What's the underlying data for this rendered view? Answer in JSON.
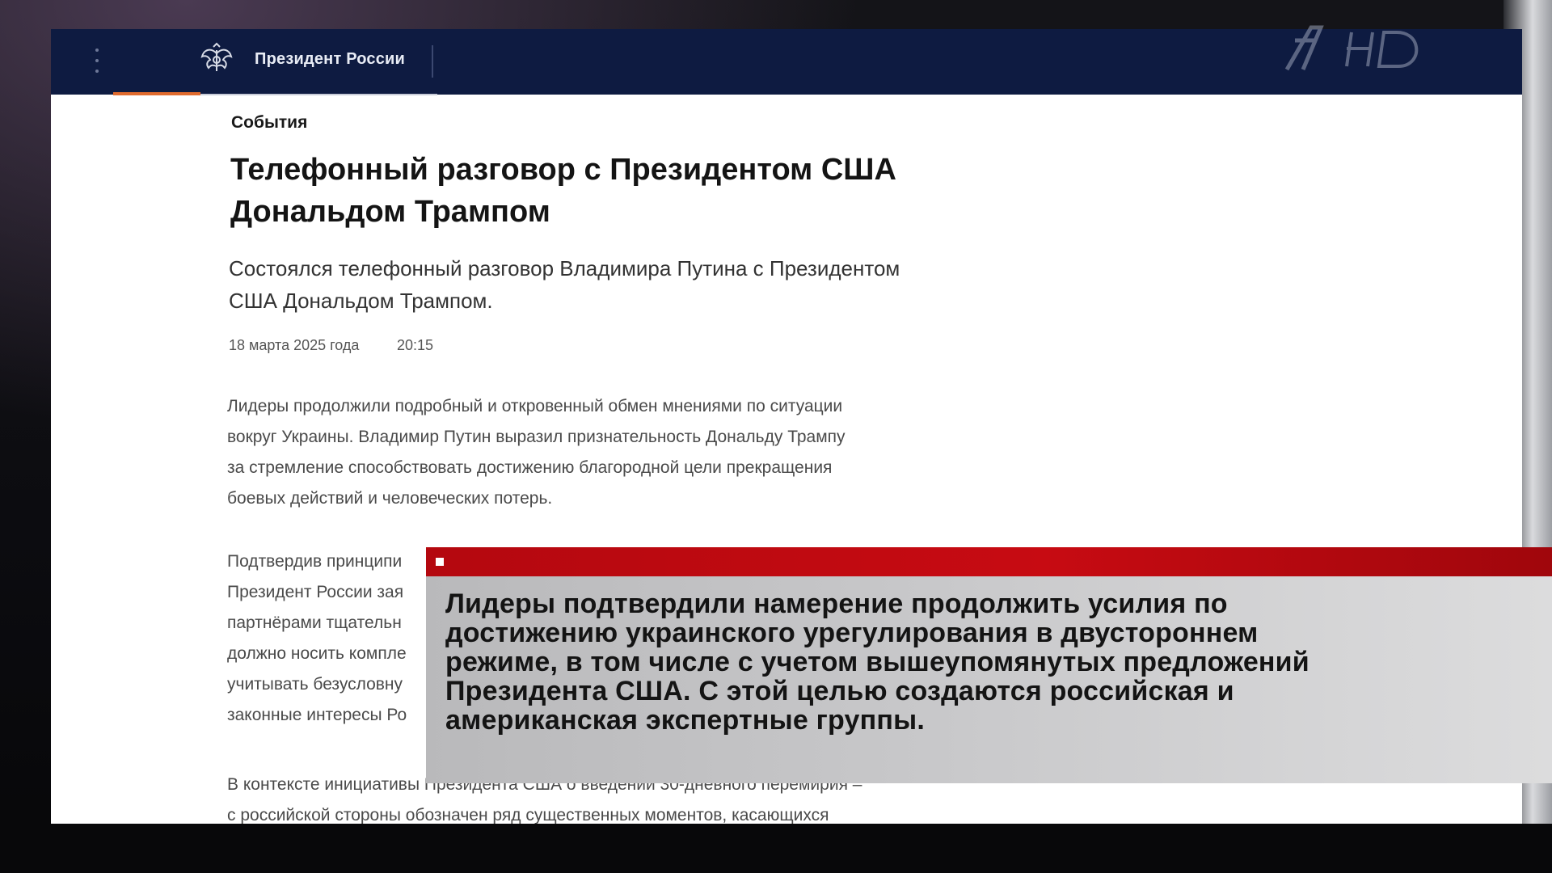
{
  "header": {
    "site_title": "Президент России",
    "icons": [
      "menu-dots-icon",
      "double-headed-eagle-icon"
    ],
    "accent_color": "#e06b2e",
    "bar_color": "#0e1b41"
  },
  "article": {
    "category": "События",
    "headline_line1": "Телефонный разговор с Президентом США",
    "headline_line2": "Дональдом Трампом",
    "lead_line1": "Состоялся телефонный разговор Владимира Путина с Президентом",
    "lead_line2": "США Дональдом Трампом.",
    "date": "18 марта 2025 года",
    "time": "20:15",
    "paragraph1": [
      "Лидеры продолжили подробный и откровенный обмен мнениями по ситуации",
      "вокруг Украины. Владимир Путин выразил признательность Дональду Трампу",
      "за стремление способствовать достижению благородной цели прекращения",
      "боевых действий и человеческих потерь."
    ],
    "paragraph2_visible": [
      "Подтвердив принципи",
      "Президент России зая",
      "партнёрами тщательн",
      "должно носить компле",
      "учитывать безусловну",
      "законные интересы Ро"
    ],
    "paragraph3": [
      "В контексте инициативы Президента США о введении 30-дневного перемирия –",
      "с российской стороны обозначен ряд существенных моментов, касающихся"
    ]
  },
  "ticker": {
    "bar_color": "#c70b12",
    "lines": [
      "Лидеры подтвердили намерение продолжить усилия по",
      "достижению украинского урегулирования в двустороннем",
      "режиме, в том числе с учетом вышеупомянутых предложений",
      "Президента США. С этой целью создаются российская и",
      "американская экспертные группы."
    ]
  },
  "overlay": {
    "channel_logo_icon": "channel-one-hd-logo-icon"
  }
}
